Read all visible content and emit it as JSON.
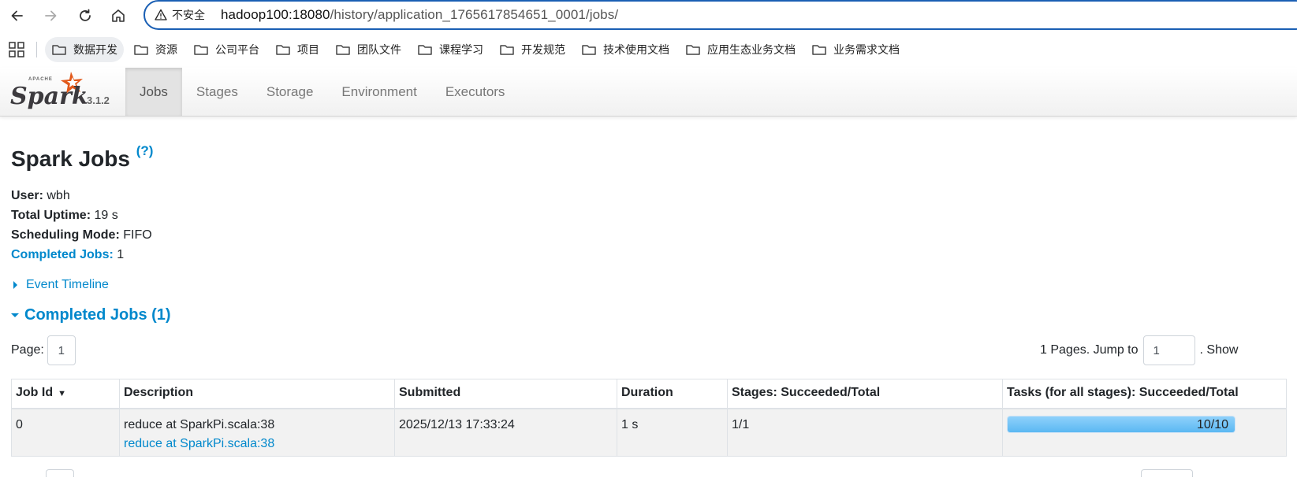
{
  "browser": {
    "security_label": "不安全",
    "url_host": "hadoop100:18080",
    "url_path": "/history/application_1765617854651_0001/jobs/"
  },
  "bookmarks": [
    "数据开发",
    "资源",
    "公司平台",
    "项目",
    "团队文件",
    "课程学习",
    "开发规范",
    "技术使用文档",
    "应用生态业务文档",
    "业务需求文档"
  ],
  "spark": {
    "version": "3.1.2",
    "tabs": [
      "Jobs",
      "Stages",
      "Storage",
      "Environment",
      "Executors"
    ],
    "active_tab": "Jobs"
  },
  "page": {
    "title": "Spark Jobs",
    "help": "(?)",
    "user_label": "User:",
    "user_value": "wbh",
    "uptime_label": "Total Uptime:",
    "uptime_value": "19 s",
    "mode_label": "Scheduling Mode:",
    "mode_value": "FIFO",
    "completed_label": "Completed Jobs:",
    "completed_value": "1",
    "event_timeline": "Event Timeline",
    "section_title": "Completed Jobs (1)"
  },
  "pager": {
    "page_label": "Page:",
    "page_value": "1",
    "pages_text": "1 Pages. Jump to",
    "jump_value": "1",
    "show_text": ". Show"
  },
  "table": {
    "headers": [
      "Job Id",
      "Description",
      "Submitted",
      "Duration",
      "Stages: Succeeded/Total",
      "Tasks (for all stages): Succeeded/Total"
    ],
    "sort_indicator": "▼",
    "rows": [
      {
        "job_id": "0",
        "description": "reduce at SparkPi.scala:38",
        "description_link": "reduce at SparkPi.scala:38",
        "submitted": "2025/12/13 17:33:24",
        "duration": "1 s",
        "stages": "1/1",
        "tasks": "10/10",
        "tasks_fraction": 1.0
      }
    ]
  },
  "colors": {
    "link": "#0088cc",
    "progress": "#5bb8f2",
    "address_border": "#1a5fb4"
  }
}
